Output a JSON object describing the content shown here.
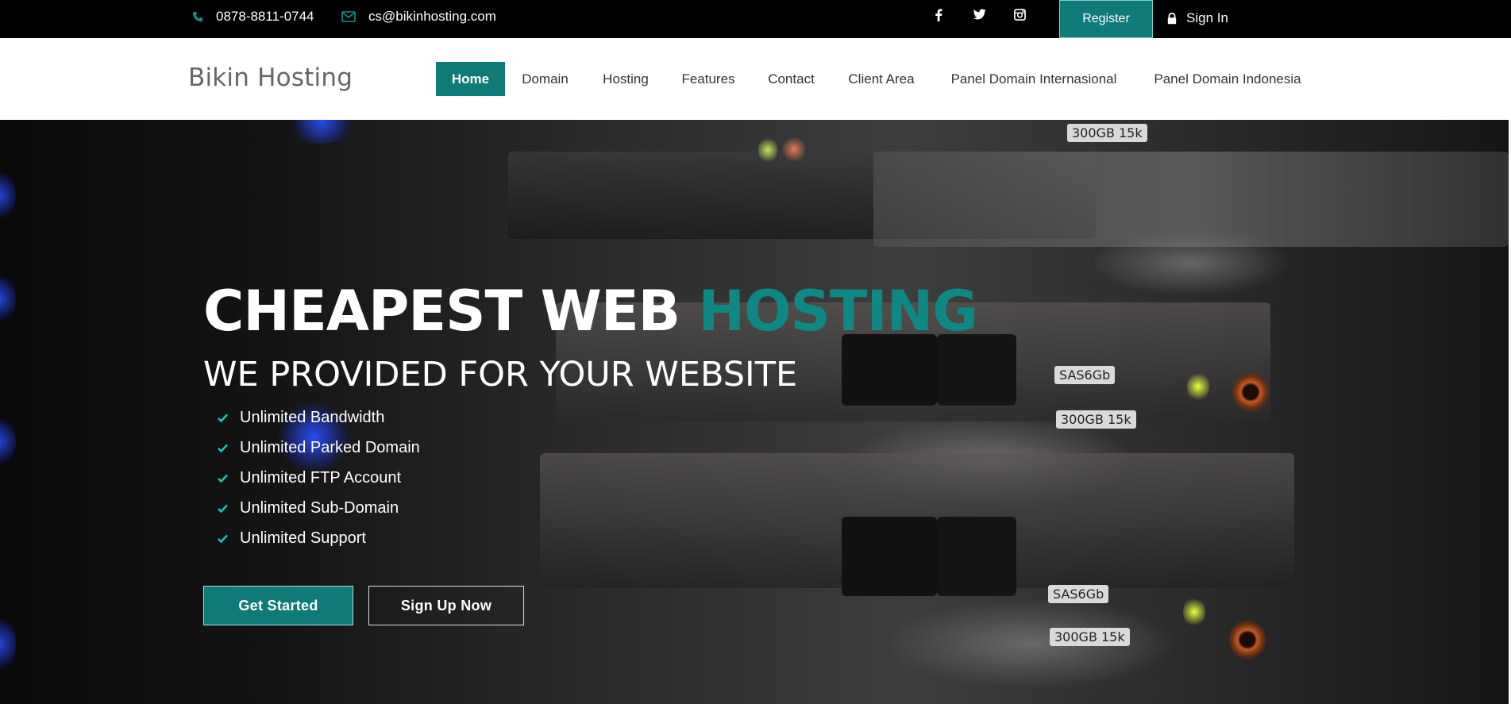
{
  "topbar": {
    "phone": "0878-8811-0744",
    "email": "cs@bikinhosting.com",
    "phone_icon": "phone-icon",
    "email_icon": "envelope-icon",
    "social": [
      {
        "name": "facebook-icon"
      },
      {
        "name": "twitter-icon"
      },
      {
        "name": "instagram-icon"
      }
    ],
    "register_label": "Register",
    "signin_label": "Sign In",
    "signin_icon": "lock-icon",
    "accent_color": "#0f7b78"
  },
  "navbar": {
    "brand": "Bikin Hosting",
    "items": [
      {
        "label": "Home",
        "active": true
      },
      {
        "label": "Domain",
        "active": false
      },
      {
        "label": "Hosting",
        "active": false
      },
      {
        "label": "Features",
        "active": false
      },
      {
        "label": "Contact",
        "active": false
      },
      {
        "label": "Client Area",
        "active": false
      },
      {
        "label": "Panel Domain Internasional",
        "active": false
      },
      {
        "label": "Panel Domain Indonesia",
        "active": false
      }
    ]
  },
  "hero": {
    "headline_main": "CHEAPEST WEB ",
    "headline_accent": "HOSTING",
    "subheadline": "WE PROVIDED FOR YOUR WEBSITE",
    "features": [
      "Unlimited Bandwidth",
      "Unlimited Parked Domain",
      "Unlimited FTP Account",
      "Unlimited Sub-Domain",
      "Unlimited Support"
    ],
    "primary_button": "Get Started",
    "secondary_button": "Sign Up Now",
    "background_labels": {
      "top": "300GB 15k",
      "mid_sas": "SAS6Gb",
      "mid_cap": "300GB 15k",
      "low_sas": "SAS6Gb",
      "low_cap": "300GB 15k"
    }
  }
}
